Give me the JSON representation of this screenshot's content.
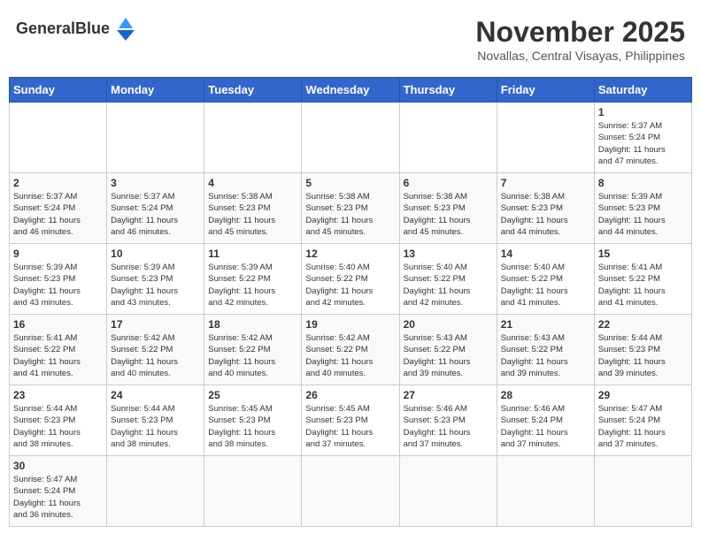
{
  "header": {
    "logo_text_regular": "General",
    "logo_text_bold": "Blue",
    "month": "November 2025",
    "location": "Novallas, Central Visayas, Philippines"
  },
  "weekdays": [
    "Sunday",
    "Monday",
    "Tuesday",
    "Wednesday",
    "Thursday",
    "Friday",
    "Saturday"
  ],
  "weeks": [
    [
      {
        "day": "",
        "info": ""
      },
      {
        "day": "",
        "info": ""
      },
      {
        "day": "",
        "info": ""
      },
      {
        "day": "",
        "info": ""
      },
      {
        "day": "",
        "info": ""
      },
      {
        "day": "",
        "info": ""
      },
      {
        "day": "1",
        "info": "Sunrise: 5:37 AM\nSunset: 5:24 PM\nDaylight: 11 hours\nand 47 minutes."
      }
    ],
    [
      {
        "day": "2",
        "info": "Sunrise: 5:37 AM\nSunset: 5:24 PM\nDaylight: 11 hours\nand 46 minutes."
      },
      {
        "day": "3",
        "info": "Sunrise: 5:37 AM\nSunset: 5:24 PM\nDaylight: 11 hours\nand 46 minutes."
      },
      {
        "day": "4",
        "info": "Sunrise: 5:38 AM\nSunset: 5:23 PM\nDaylight: 11 hours\nand 45 minutes."
      },
      {
        "day": "5",
        "info": "Sunrise: 5:38 AM\nSunset: 5:23 PM\nDaylight: 11 hours\nand 45 minutes."
      },
      {
        "day": "6",
        "info": "Sunrise: 5:38 AM\nSunset: 5:23 PM\nDaylight: 11 hours\nand 45 minutes."
      },
      {
        "day": "7",
        "info": "Sunrise: 5:38 AM\nSunset: 5:23 PM\nDaylight: 11 hours\nand 44 minutes."
      },
      {
        "day": "8",
        "info": "Sunrise: 5:39 AM\nSunset: 5:23 PM\nDaylight: 11 hours\nand 44 minutes."
      }
    ],
    [
      {
        "day": "9",
        "info": "Sunrise: 5:39 AM\nSunset: 5:23 PM\nDaylight: 11 hours\nand 43 minutes."
      },
      {
        "day": "10",
        "info": "Sunrise: 5:39 AM\nSunset: 5:23 PM\nDaylight: 11 hours\nand 43 minutes."
      },
      {
        "day": "11",
        "info": "Sunrise: 5:39 AM\nSunset: 5:22 PM\nDaylight: 11 hours\nand 42 minutes."
      },
      {
        "day": "12",
        "info": "Sunrise: 5:40 AM\nSunset: 5:22 PM\nDaylight: 11 hours\nand 42 minutes."
      },
      {
        "day": "13",
        "info": "Sunrise: 5:40 AM\nSunset: 5:22 PM\nDaylight: 11 hours\nand 42 minutes."
      },
      {
        "day": "14",
        "info": "Sunrise: 5:40 AM\nSunset: 5:22 PM\nDaylight: 11 hours\nand 41 minutes."
      },
      {
        "day": "15",
        "info": "Sunrise: 5:41 AM\nSunset: 5:22 PM\nDaylight: 11 hours\nand 41 minutes."
      }
    ],
    [
      {
        "day": "16",
        "info": "Sunrise: 5:41 AM\nSunset: 5:22 PM\nDaylight: 11 hours\nand 41 minutes."
      },
      {
        "day": "17",
        "info": "Sunrise: 5:42 AM\nSunset: 5:22 PM\nDaylight: 11 hours\nand 40 minutes."
      },
      {
        "day": "18",
        "info": "Sunrise: 5:42 AM\nSunset: 5:22 PM\nDaylight: 11 hours\nand 40 minutes."
      },
      {
        "day": "19",
        "info": "Sunrise: 5:42 AM\nSunset: 5:22 PM\nDaylight: 11 hours\nand 40 minutes."
      },
      {
        "day": "20",
        "info": "Sunrise: 5:43 AM\nSunset: 5:22 PM\nDaylight: 11 hours\nand 39 minutes."
      },
      {
        "day": "21",
        "info": "Sunrise: 5:43 AM\nSunset: 5:22 PM\nDaylight: 11 hours\nand 39 minutes."
      },
      {
        "day": "22",
        "info": "Sunrise: 5:44 AM\nSunset: 5:23 PM\nDaylight: 11 hours\nand 39 minutes."
      }
    ],
    [
      {
        "day": "23",
        "info": "Sunrise: 5:44 AM\nSunset: 5:23 PM\nDaylight: 11 hours\nand 38 minutes."
      },
      {
        "day": "24",
        "info": "Sunrise: 5:44 AM\nSunset: 5:23 PM\nDaylight: 11 hours\nand 38 minutes."
      },
      {
        "day": "25",
        "info": "Sunrise: 5:45 AM\nSunset: 5:23 PM\nDaylight: 11 hours\nand 38 minutes."
      },
      {
        "day": "26",
        "info": "Sunrise: 5:45 AM\nSunset: 5:23 PM\nDaylight: 11 hours\nand 37 minutes."
      },
      {
        "day": "27",
        "info": "Sunrise: 5:46 AM\nSunset: 5:23 PM\nDaylight: 11 hours\nand 37 minutes."
      },
      {
        "day": "28",
        "info": "Sunrise: 5:46 AM\nSunset: 5:24 PM\nDaylight: 11 hours\nand 37 minutes."
      },
      {
        "day": "29",
        "info": "Sunrise: 5:47 AM\nSunset: 5:24 PM\nDaylight: 11 hours\nand 37 minutes."
      }
    ],
    [
      {
        "day": "30",
        "info": "Sunrise: 5:47 AM\nSunset: 5:24 PM\nDaylight: 11 hours\nand 36 minutes."
      },
      {
        "day": "",
        "info": ""
      },
      {
        "day": "",
        "info": ""
      },
      {
        "day": "",
        "info": ""
      },
      {
        "day": "",
        "info": ""
      },
      {
        "day": "",
        "info": ""
      },
      {
        "day": "",
        "info": ""
      }
    ]
  ]
}
